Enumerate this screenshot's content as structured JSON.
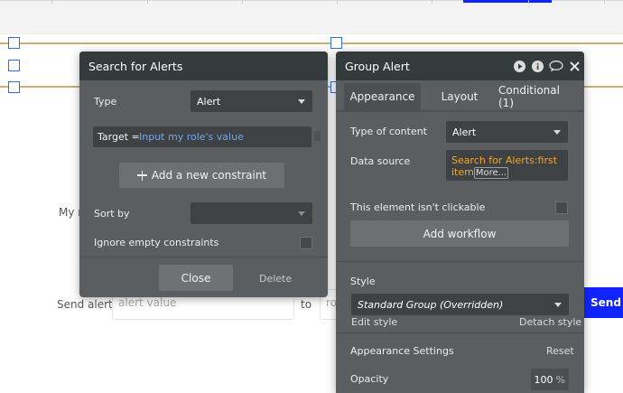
{
  "background": {
    "my_label": "My r",
    "send_alert_label": "Send alert",
    "alert_input_placeholder": "alert value",
    "to_label": "to",
    "role_input_placeholder": "ro",
    "send_button_label": "Send"
  },
  "search_panel": {
    "title": "Search for Alerts",
    "type_label": "Type",
    "type_value": "Alert",
    "constraint_key": "Target =",
    "constraint_value": "Input my role's value",
    "add_constraint_label": "Add a new constraint",
    "sort_by_label": "Sort by",
    "sort_by_value": "",
    "ignore_empty_label": "Ignore empty constraints",
    "close_label": "Close",
    "delete_label": "Delete"
  },
  "group_panel": {
    "title": "Group Alert",
    "tabs": [
      {
        "label": "Appearance",
        "active": true
      },
      {
        "label": "Layout",
        "active": false
      },
      {
        "label": "Conditional (1)",
        "active": false
      }
    ],
    "type_of_content_label": "Type of content",
    "type_of_content_value": "Alert",
    "data_source_label": "Data source",
    "data_source_value_line1": "Search for Alerts:first",
    "data_source_value_line2": "item",
    "data_source_more": "More...",
    "not_clickable_label": "This element isn't clickable",
    "add_workflow_label": "Add workflow",
    "style_label": "Style",
    "style_value": "Standard Group (Overridden)",
    "edit_style_label": "Edit style",
    "detach_style_label": "Detach style",
    "appearance_settings_label": "Appearance Settings",
    "reset_label": "Reset",
    "opacity_label": "Opacity",
    "opacity_value": "100",
    "opacity_unit": "%"
  },
  "colors": {
    "brand_blue": "#1024ff",
    "panel_bg": "#5b5e60",
    "panel_header": "#353a3d",
    "link_blue": "#6fa8ec",
    "dynamic_orange": "#f5a623",
    "selection_handle": "#2f6fe0"
  },
  "icons": [
    "trash-icon",
    "plus-icon",
    "play-icon",
    "info-icon",
    "comment-icon",
    "close-icon",
    "caret-down-icon"
  ]
}
